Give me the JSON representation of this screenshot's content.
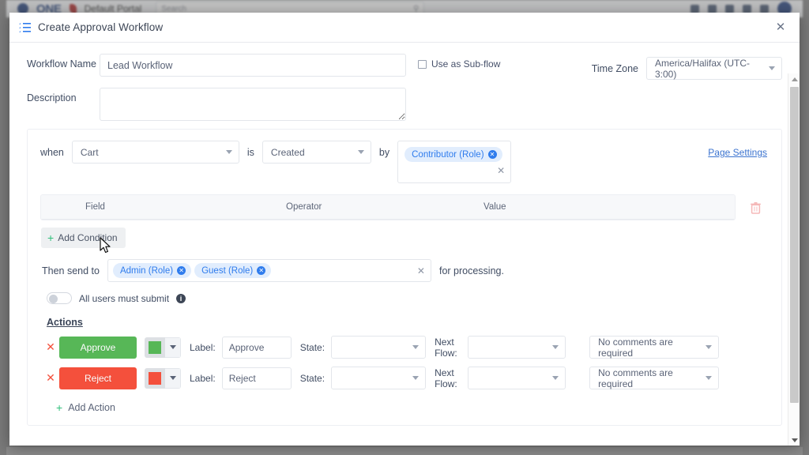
{
  "background_app": {
    "logo_text": "ONE",
    "portal_text": "Default Portal",
    "search_placeholder": "Search"
  },
  "modal": {
    "title": "Create Approval Workflow",
    "title_icon": "ordered-list-icon",
    "close_icon": "close-icon"
  },
  "form": {
    "workflow_name_label": "Workflow Name",
    "workflow_name_value": "Lead Workflow",
    "description_label": "Description",
    "description_value": "",
    "subflow_label": "Use as Sub-flow",
    "subflow_checked": false,
    "timezone_label": "Time Zone",
    "timezone_value": "America/Halifax (UTC-3:00)"
  },
  "trigger": {
    "when_word": "when",
    "entity_value": "Cart",
    "is_word": "is",
    "event_value": "Created",
    "by_word": "by",
    "by_chips": [
      {
        "label": "Contributor (Role)"
      }
    ],
    "clear_icon": "clear-x-icon",
    "page_settings_link": "Page Settings"
  },
  "conditions": {
    "columns": [
      "Field",
      "Operator",
      "Value"
    ],
    "rows": [],
    "add_condition_label": "Add Condition",
    "delete_icon": "trash-icon"
  },
  "send_to": {
    "prefix_label": "Then send to",
    "chips": [
      {
        "label": "Admin (Role)"
      },
      {
        "label": "Guest (Role)"
      }
    ],
    "suffix_label": "for processing.",
    "toggle_label": "All users must submit",
    "toggle_on": false,
    "info_icon": "info-icon",
    "info_glyph": "i"
  },
  "actions": {
    "title": "Actions",
    "label_caption": "Label:",
    "state_caption": "State:",
    "next_flow_caption_line1": "Next",
    "next_flow_caption_line2": "Flow:",
    "add_action_label": "Add Action",
    "remove_icon": "remove-action-icon",
    "rows": [
      {
        "button_text": "Approve",
        "button_color": "#57b757",
        "swatch_color": "#57b757",
        "label_value": "Approve",
        "state_value": "",
        "next_flow_value": "",
        "comments_value": "No comments are required"
      },
      {
        "button_text": "Reject",
        "button_color": "#f4503c",
        "swatch_color": "#f4503c",
        "label_value": "Reject",
        "state_value": "",
        "next_flow_value": "",
        "comments_value": "No comments are required"
      }
    ]
  },
  "scrollbar": {
    "up_icon": "scroll-up-arrow-icon",
    "down_icon": "scroll-down-arrow-icon"
  },
  "colors": {
    "accent_blue": "#2f7ced",
    "link_blue": "#3b73cf",
    "green": "#31c07b",
    "approve_green": "#57b757",
    "reject_red": "#f4503c"
  }
}
